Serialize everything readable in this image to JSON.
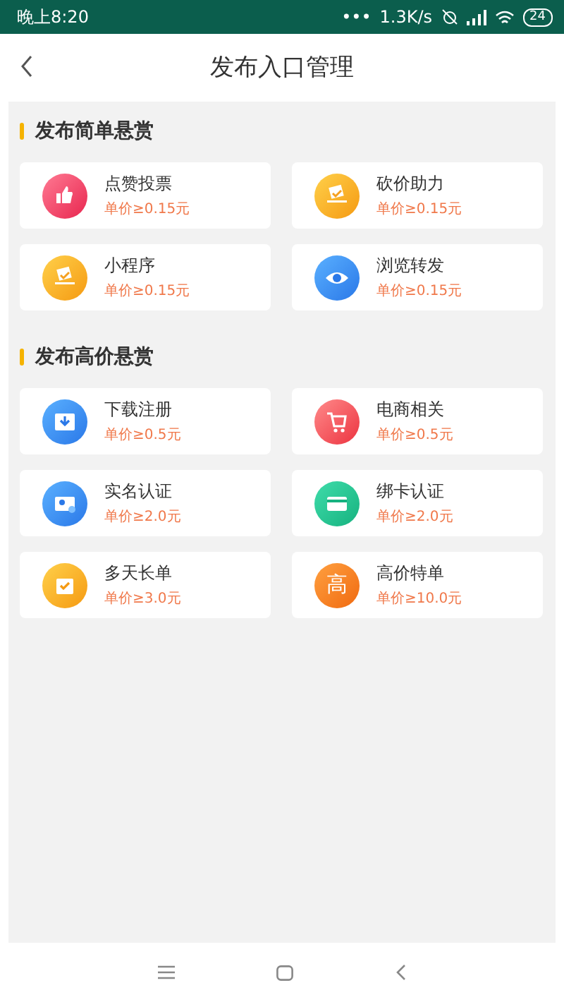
{
  "status_bar": {
    "time": "晚上8:20",
    "dots": "•••",
    "speed": "1.3K/s",
    "battery": "24"
  },
  "header": {
    "title": "发布入口管理"
  },
  "sections": [
    {
      "title": "发布简单悬赏",
      "items": [
        {
          "name": "点赞投票",
          "price": "单价≥0.15元",
          "kind": "thumb"
        },
        {
          "name": "砍价助力",
          "price": "单价≥0.15元",
          "kind": "ticket"
        },
        {
          "name": "小程序",
          "price": "单价≥0.15元",
          "kind": "ticket"
        },
        {
          "name": "浏览转发",
          "price": "单价≥0.15元",
          "kind": "eye"
        }
      ]
    },
    {
      "title": "发布高价悬赏",
      "items": [
        {
          "name": "下载注册",
          "price": "单价≥0.5元",
          "kind": "download"
        },
        {
          "name": "电商相关",
          "price": "单价≥0.5元",
          "kind": "cart"
        },
        {
          "name": "实名认证",
          "price": "单价≥2.0元",
          "kind": "idcard"
        },
        {
          "name": "绑卡认证",
          "price": "单价≥2.0元",
          "kind": "card"
        },
        {
          "name": "多天长单",
          "price": "单价≥3.0元",
          "kind": "calendar"
        },
        {
          "name": "高价特单",
          "price": "单价≥10.0元",
          "kind": "glyph",
          "glyph": "高"
        }
      ]
    }
  ]
}
